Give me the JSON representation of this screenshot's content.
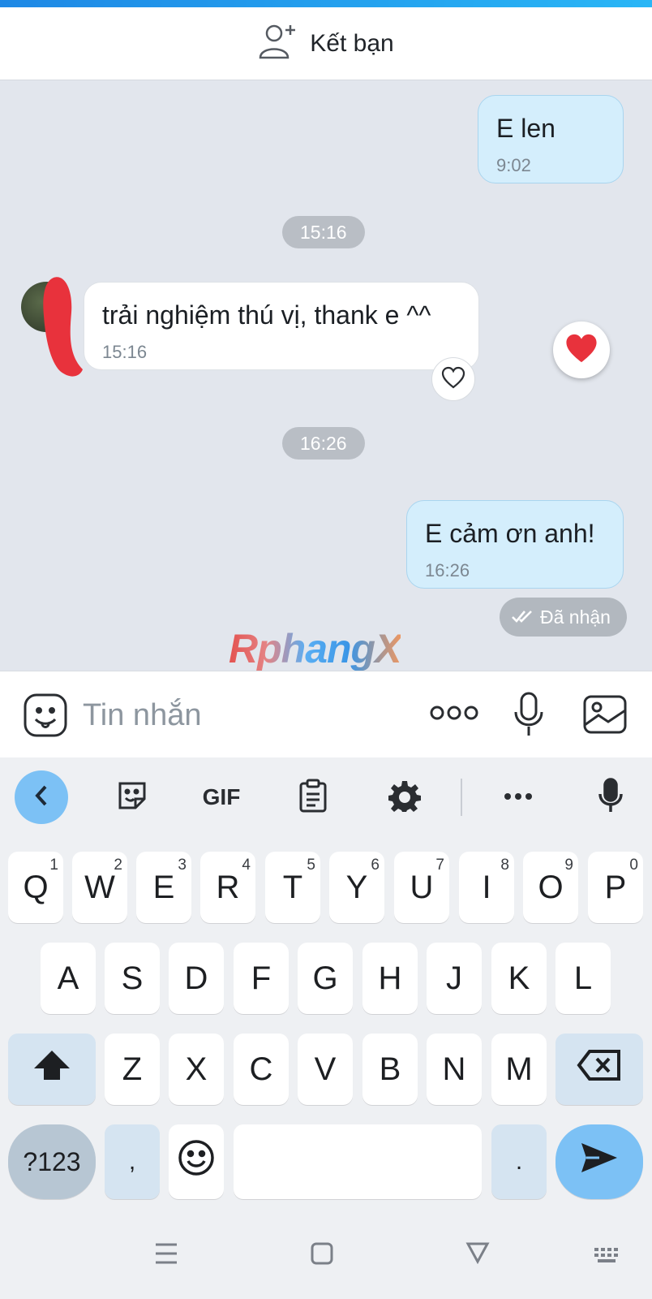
{
  "header": {
    "add_friend_label": "Kết bạn"
  },
  "chat": {
    "messages": [
      {
        "direction": "out",
        "text": "E len",
        "time": "9:02"
      },
      {
        "direction": "in",
        "text": "trải nghiệm thú vị, thank e ^^",
        "time": "15:16"
      },
      {
        "direction": "out",
        "text": "E cảm ơn anh!",
        "time": "16:26"
      }
    ],
    "separators": [
      "15:16",
      "16:26"
    ],
    "status_label": "Đã nhận",
    "watermark": "RphangX"
  },
  "composer": {
    "placeholder": "Tin nhắn"
  },
  "keyboard": {
    "toolbar": {
      "gif_label": "GIF"
    },
    "row1": [
      {
        "key": "Q",
        "num": "1"
      },
      {
        "key": "W",
        "num": "2"
      },
      {
        "key": "E",
        "num": "3"
      },
      {
        "key": "R",
        "num": "4"
      },
      {
        "key": "T",
        "num": "5"
      },
      {
        "key": "Y",
        "num": "6"
      },
      {
        "key": "U",
        "num": "7"
      },
      {
        "key": "I",
        "num": "8"
      },
      {
        "key": "O",
        "num": "9"
      },
      {
        "key": "P",
        "num": "0"
      }
    ],
    "row2": [
      "A",
      "S",
      "D",
      "F",
      "G",
      "H",
      "J",
      "K",
      "L"
    ],
    "row3": [
      "Z",
      "X",
      "C",
      "V",
      "B",
      "N",
      "M"
    ],
    "row4": {
      "symbols": "?123",
      "comma": ",",
      "period": "."
    }
  },
  "colors": {
    "accent": "#7cc1f5",
    "outgoing_bubble": "#d4eefc",
    "chat_bg": "#e2e6ed",
    "heart": "#e8323c"
  }
}
